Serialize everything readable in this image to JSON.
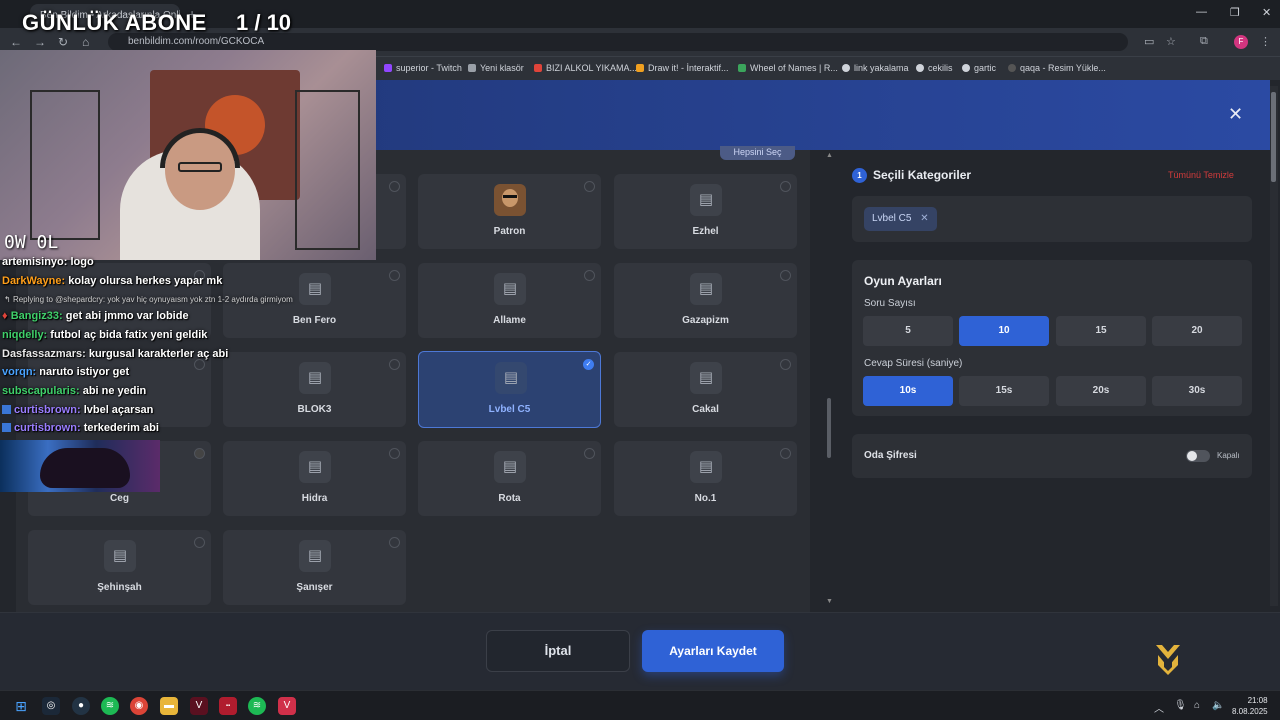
{
  "overlay": {
    "title": "GÜNLÜK ABONE",
    "count": "1 / 10",
    "cam_label": "0W 0L"
  },
  "browser": {
    "tab_title": "Ben Bildim • Arkadaşlarınla Online",
    "url": "benbildim.com/room/GCKOCA",
    "bookmarks": [
      {
        "label": "superior - Twitch",
        "color": "#9146ff"
      },
      {
        "label": "Yeni klasör",
        "color": "#9aa0a8"
      },
      {
        "label": "BIZI ALKOL YIKAMA...",
        "color": "#e0443a"
      },
      {
        "label": "Draw it! - İnteraktif...",
        "color": "#f0a020"
      },
      {
        "label": "Wheel of Names | R...",
        "color": "#3ba55c"
      },
      {
        "label": "link yakalama",
        "color": "#cfd3da"
      },
      {
        "label": "cekilis",
        "color": "#cfd3da"
      },
      {
        "label": "gartic",
        "color": "#cfd3da"
      },
      {
        "label": "qaqa - Resim Yükle...",
        "color": "#cfd3da"
      }
    ],
    "profile_initial": "F"
  },
  "categories": {
    "select_all": "Hepsini Seç",
    "items": [
      {
        "label": "Patron",
        "icon": "avatar-photo"
      },
      {
        "label": "Ezhel",
        "icon": "building-icon"
      },
      {
        "label": "Ben Fero",
        "icon": "building-icon"
      },
      {
        "label": "Allame",
        "icon": "building-icon"
      },
      {
        "label": "Gazapizm",
        "icon": "building-icon"
      },
      {
        "label": "BLOK3",
        "icon": "building-icon"
      },
      {
        "label": "Lvbel C5",
        "icon": "building-icon",
        "selected": true
      },
      {
        "label": "Cakal",
        "icon": "building-icon"
      },
      {
        "label": "Ceg",
        "icon": "building-icon"
      },
      {
        "label": "Hidra",
        "icon": "building-icon"
      },
      {
        "label": "Rota",
        "icon": "building-icon"
      },
      {
        "label": "No.1",
        "icon": "building-icon"
      },
      {
        "label": "Şehinşah",
        "icon": "building-icon"
      },
      {
        "label": "Şanışer",
        "icon": "building-icon"
      }
    ]
  },
  "selected": {
    "count": "1",
    "title": "Seçili Kategoriler",
    "clear_all": "Tümünü Temizle",
    "chips": [
      "Lvbel C5"
    ]
  },
  "game_settings": {
    "title": "Oyun Ayarları",
    "question_count_label": "Soru Sayısı",
    "question_options": [
      "5",
      "10",
      "15",
      "20"
    ],
    "question_selected": "10",
    "answer_time_label": "Cevap Süresi (saniye)",
    "time_options": [
      "10s",
      "15s",
      "20s",
      "30s"
    ],
    "time_selected": "10s",
    "password_label": "Oda Şifresi",
    "password_state": "Kapalı"
  },
  "footer": {
    "cancel": "İptal",
    "save": "Ayarları Kaydet"
  },
  "chat": [
    {
      "user": "artemisinyo:",
      "text": "logo",
      "color": "#ffffff"
    },
    {
      "user": "DarkWayne:",
      "text": "kolay olursa herkes yapar mk",
      "color": "#ff9f1a"
    },
    {
      "reply": "Replying to @shepardcry: yok yav hiç oynuyaısm yok ztn 1-2 aydırda girmiyom"
    },
    {
      "user": "Bangiz33:",
      "text": "get abi jmmo var lobide",
      "color": "#3fd06a"
    },
    {
      "user": "niqdelly:",
      "text": "futbol aç bida fatix yeni geldik",
      "color": "#3fd06a"
    },
    {
      "user": "Dasfassazmars:",
      "text": "kurgusal karakterler aç abi",
      "color": "#e9e9e9"
    },
    {
      "user": "vorqn:",
      "text": "naruto istiyor get",
      "color": "#4aa3ff"
    },
    {
      "user": "subscapularis:",
      "text": "abi ne yedin",
      "color": "#3fd06a"
    },
    {
      "user": "curtisbrown:",
      "text": "lvbel açarsan",
      "color": "#9a7dff"
    },
    {
      "user": "curtisbrown:",
      "text": "terkederim abi",
      "color": "#9a7dff"
    }
  ],
  "taskbar": {
    "time": "21:08",
    "date": "8.08.2025"
  },
  "colors": {
    "accent": "#2f62d6",
    "danger": "#d23b3b",
    "header_gradient_start": "#1f3470",
    "header_gradient_end": "#2b4aa3"
  }
}
